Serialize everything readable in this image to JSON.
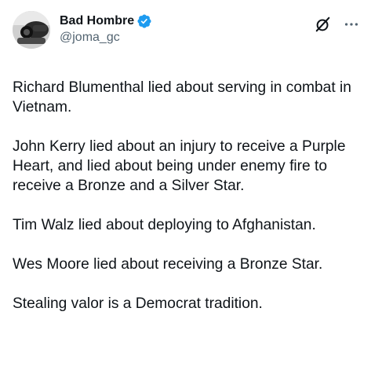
{
  "author": {
    "display_name": "Bad Hombre",
    "handle": "@joma_gc",
    "verified": true,
    "avatar_icon": "avatar-photo"
  },
  "header_actions": {
    "grok_icon": "grok-icon",
    "more_icon": "more-icon"
  },
  "colors": {
    "text": "#0f1419",
    "secondary": "#536471",
    "verified_blue": "#1d9bf0"
  },
  "tweet": {
    "paragraphs": [
      "Richard Blumenthal lied about serving in combat in Vietnam.",
      "John Kerry lied about an injury to receive a Purple Heart, and lied about being under enemy fire to receive a Bronze and a Silver Star.",
      "Tim Walz lied about deploying to Afghanistan.",
      "Wes Moore lied about receiving a Bronze Star.",
      "Stealing valor is a Democrat tradition."
    ]
  }
}
